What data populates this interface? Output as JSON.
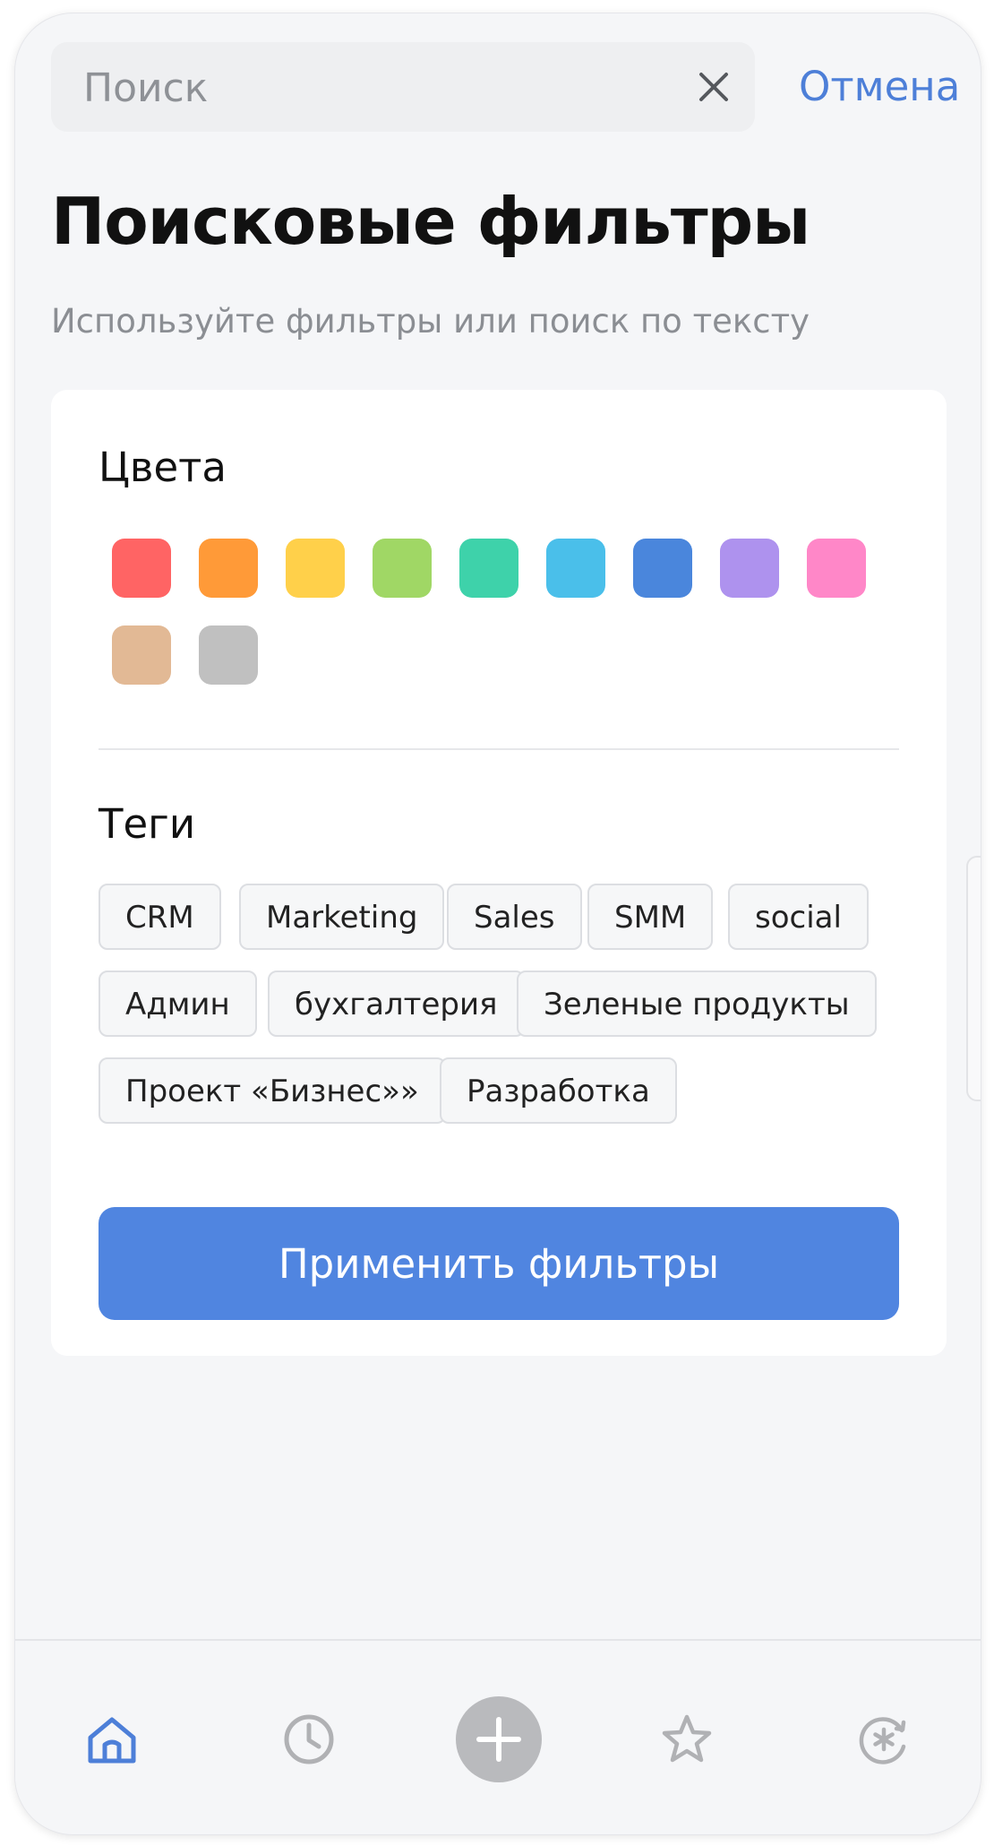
{
  "search": {
    "placeholder": "Поиск",
    "value": "",
    "cancel_label": "Отмена",
    "clear_icon": "close-icon"
  },
  "header": {
    "title": "Поисковые фильтры",
    "subtitle": "Используйте фильтры или поиск по тексту"
  },
  "colors_section": {
    "title": "Цвета",
    "swatches": [
      {
        "name": "red",
        "hex": "#ff6464"
      },
      {
        "name": "orange",
        "hex": "#ff9a38"
      },
      {
        "name": "yellow",
        "hex": "#ffd04a"
      },
      {
        "name": "green",
        "hex": "#a0d765"
      },
      {
        "name": "teal",
        "hex": "#3ed2aa"
      },
      {
        "name": "light-blue",
        "hex": "#4abfea"
      },
      {
        "name": "blue",
        "hex": "#4a86dc"
      },
      {
        "name": "purple",
        "hex": "#ae92ee"
      },
      {
        "name": "pink",
        "hex": "#ff87c8"
      },
      {
        "name": "beige",
        "hex": "#e2b995"
      },
      {
        "name": "gray",
        "hex": "#c0c0c0"
      }
    ]
  },
  "tags_section": {
    "title": "Теги",
    "tags": [
      "CRM",
      "Marketing",
      "Sales",
      "SMM",
      "social",
      "Админ",
      "бухгалтерия",
      "Зеленые продукты",
      "Проект «Бизнес»»",
      "Разработка"
    ]
  },
  "apply_button": {
    "label": "Применить фильтры"
  },
  "tabbar": {
    "items": [
      {
        "icon": "home-icon",
        "active": true
      },
      {
        "icon": "clock-icon",
        "active": false
      },
      {
        "icon": "plus-icon",
        "active": false
      },
      {
        "icon": "star-icon",
        "active": false
      },
      {
        "icon": "asterisk-refresh-icon",
        "active": false
      }
    ]
  },
  "colors": {
    "accent": "#4d7fd8",
    "button": "#5085e0",
    "background": "#f5f6f8",
    "card": "#ffffff",
    "tab_inactive": "#b0b1b4"
  }
}
